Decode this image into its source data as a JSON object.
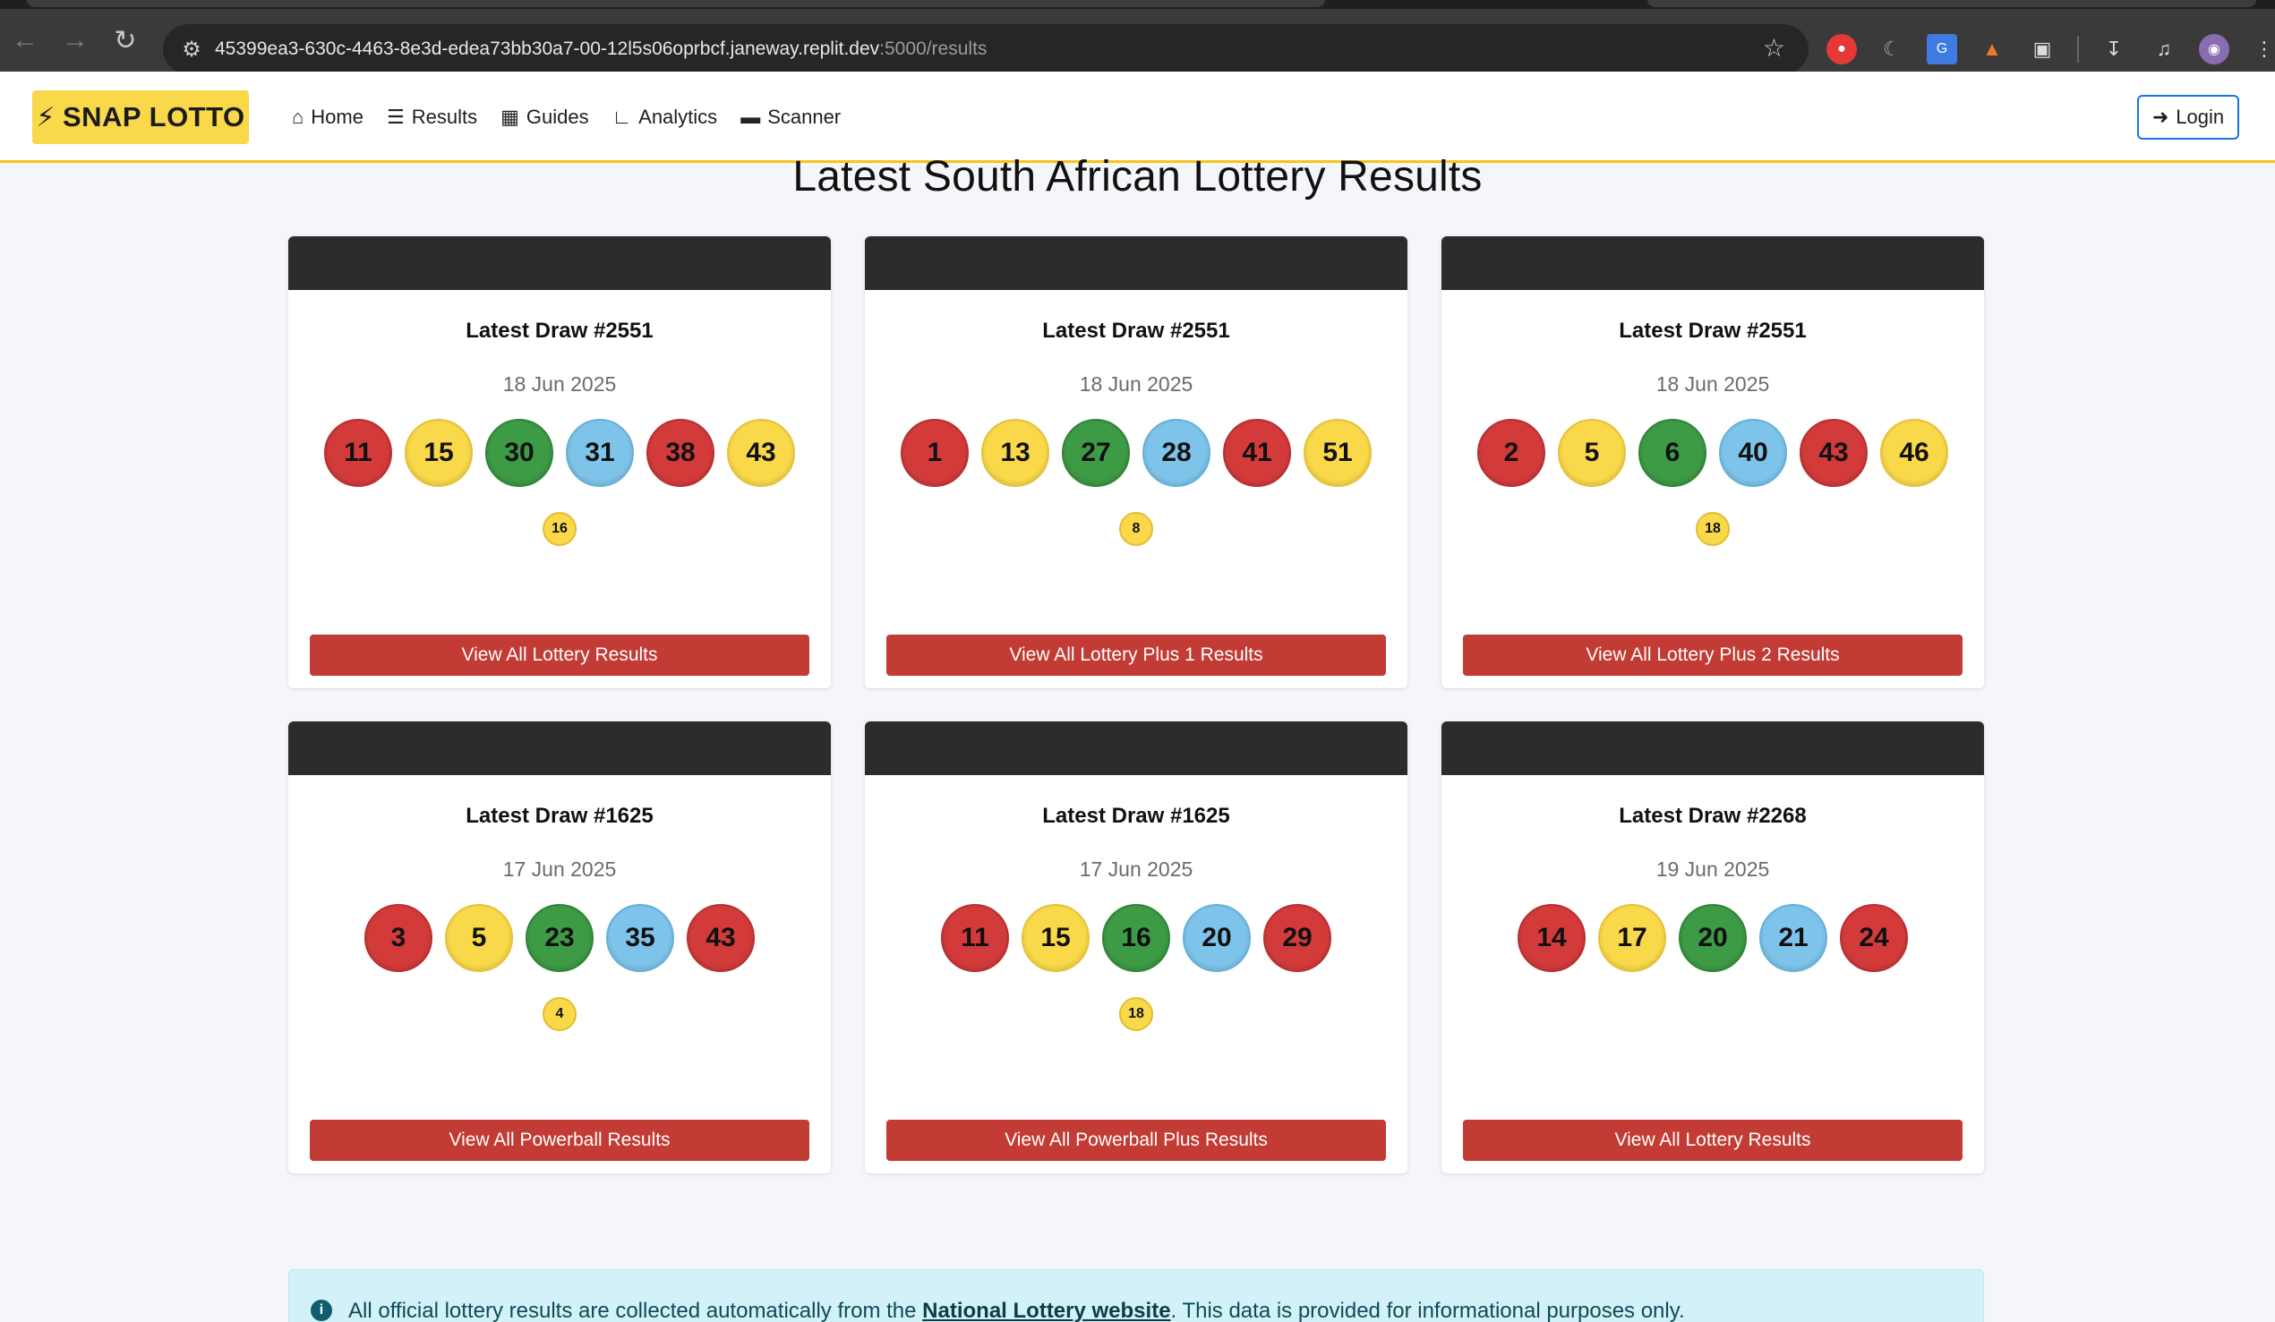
{
  "browser": {
    "url_main": "45399ea3-630c-4463-8e3d-edea73bb30a7-00-12l5s06oprbcf.janeway.replit.dev",
    "url_path": ":5000/results"
  },
  "nav": {
    "brand": "SNAP LOTTO",
    "links": [
      "Home",
      "Results",
      "Guides",
      "Analytics",
      "Scanner"
    ],
    "login": "Login"
  },
  "page": {
    "title": "Latest South African Lottery Results"
  },
  "cards": [
    {
      "draw": "Latest Draw #2551",
      "date": "18 Jun 2025",
      "balls": [
        {
          "n": "11",
          "c": "red"
        },
        {
          "n": "15",
          "c": "yellow"
        },
        {
          "n": "30",
          "c": "green"
        },
        {
          "n": "31",
          "c": "blue"
        },
        {
          "n": "38",
          "c": "red"
        },
        {
          "n": "43",
          "c": "yellow"
        }
      ],
      "bonus": "16",
      "button": "View All Lottery Results"
    },
    {
      "draw": "Latest Draw #2551",
      "date": "18 Jun 2025",
      "balls": [
        {
          "n": "1",
          "c": "red"
        },
        {
          "n": "13",
          "c": "yellow"
        },
        {
          "n": "27",
          "c": "green"
        },
        {
          "n": "28",
          "c": "blue"
        },
        {
          "n": "41",
          "c": "red"
        },
        {
          "n": "51",
          "c": "yellow"
        }
      ],
      "bonus": "8",
      "button": "View All Lottery Plus 1 Results"
    },
    {
      "draw": "Latest Draw #2551",
      "date": "18 Jun 2025",
      "balls": [
        {
          "n": "2",
          "c": "red"
        },
        {
          "n": "5",
          "c": "yellow"
        },
        {
          "n": "6",
          "c": "green"
        },
        {
          "n": "40",
          "c": "blue"
        },
        {
          "n": "43",
          "c": "red"
        },
        {
          "n": "46",
          "c": "yellow"
        }
      ],
      "bonus": "18",
      "button": "View All Lottery Plus 2 Results"
    },
    {
      "draw": "Latest Draw #1625",
      "date": "17 Jun 2025",
      "balls": [
        {
          "n": "3",
          "c": "red"
        },
        {
          "n": "5",
          "c": "yellow"
        },
        {
          "n": "23",
          "c": "green"
        },
        {
          "n": "35",
          "c": "blue"
        },
        {
          "n": "43",
          "c": "red"
        }
      ],
      "bonus": "4",
      "button": "View All Powerball Results"
    },
    {
      "draw": "Latest Draw #1625",
      "date": "17 Jun 2025",
      "balls": [
        {
          "n": "11",
          "c": "red"
        },
        {
          "n": "15",
          "c": "yellow"
        },
        {
          "n": "16",
          "c": "green"
        },
        {
          "n": "20",
          "c": "blue"
        },
        {
          "n": "29",
          "c": "red"
        }
      ],
      "bonus": "18",
      "button": "View All Powerball Plus Results"
    },
    {
      "draw": "Latest Draw #2268",
      "date": "19 Jun 2025",
      "balls": [
        {
          "n": "14",
          "c": "red"
        },
        {
          "n": "17",
          "c": "yellow"
        },
        {
          "n": "20",
          "c": "green"
        },
        {
          "n": "21",
          "c": "blue"
        },
        {
          "n": "24",
          "c": "red"
        }
      ],
      "bonus": null,
      "button": "View All Lottery Results"
    }
  ],
  "info": {
    "prefix": "All official lottery results are collected automatically from the ",
    "link": "National Lottery website",
    "suffix": ". This data is provided for informational purposes only."
  },
  "colors": {
    "brand": "#f9d94a",
    "accent_red": "#c23b34",
    "header_dark": "#2c2c2c"
  }
}
